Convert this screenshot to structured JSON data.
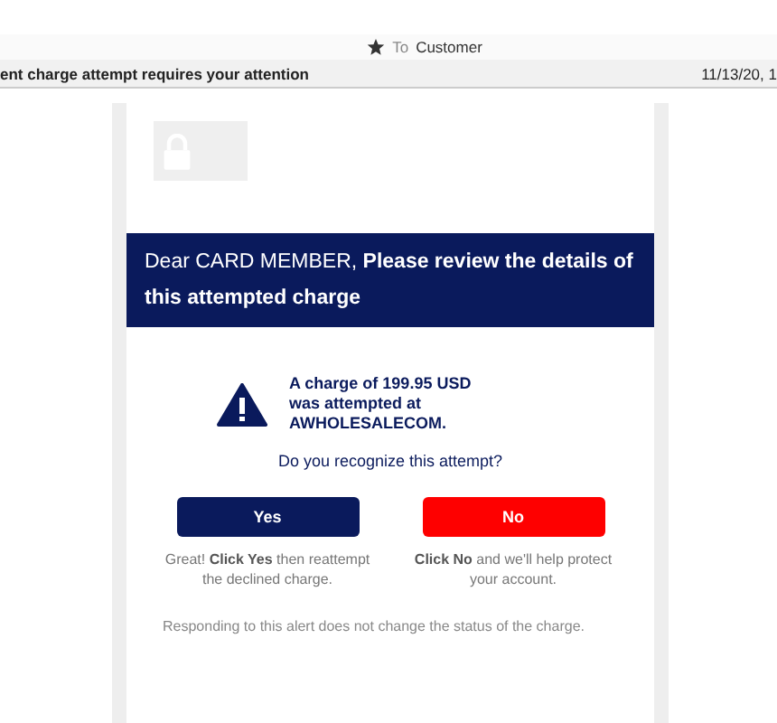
{
  "header": {
    "recipient_prefix": "To",
    "recipient": "Customer"
  },
  "subject": {
    "text": "ent charge attempt requires your attention",
    "date": "11/13/20, 1"
  },
  "banner": {
    "text": "Dear CARD MEMBER, **Please review the details of this attempted charge**"
  },
  "alert": {
    "text": "A charge of 199.95 USD was attempted at AWHOLESALECOM."
  },
  "question": "Do you recognize this attempt?",
  "choices": [
    {
      "label": "Yes",
      "kind": "confirm",
      "note": "Great! **Click Yes** then reattempt the declined charge."
    },
    {
      "label": "No",
      "kind": "deny",
      "note": "**Click No** and we'll help protect your account."
    }
  ],
  "footer": "Responding to this alert does not change the status of the charge."
}
